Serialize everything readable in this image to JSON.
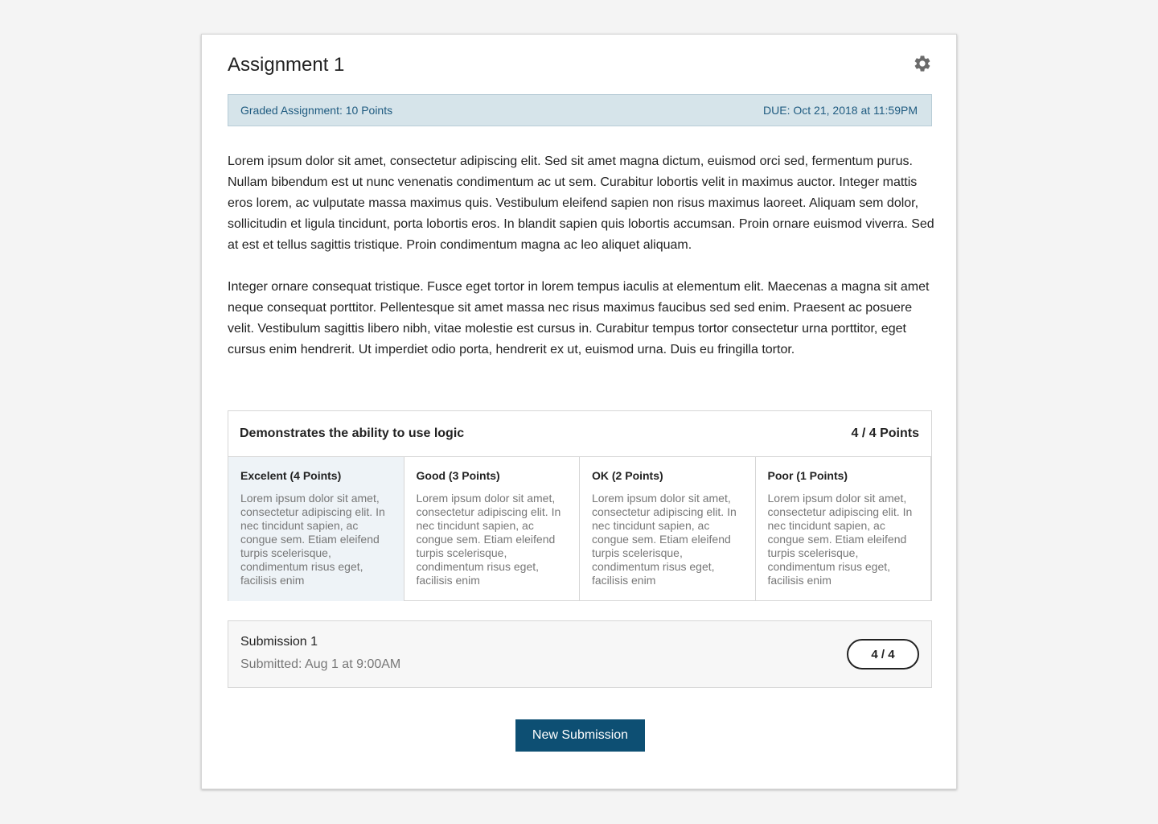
{
  "assignment": {
    "title": "Assignment 1",
    "settings_icon": "gear-icon",
    "graded_label": "Graded Assignment: 10 Points",
    "due_label": "DUE: Oct 21, 2018 at 11:59PM",
    "paragraphs": [
      "Lorem ipsum dolor sit amet, consectetur adipiscing elit. Sed sit amet magna dictum, euismod orci sed, fermentum purus. Nullam bibendum est ut nunc venenatis condimentum ac ut sem. Curabitur lobortis velit in maximus auctor. Integer mattis eros lorem, ac vulputate massa maximus quis. Vestibulum eleifend sapien non risus maximus laoreet. Aliquam sem dolor, sollicitudin et ligula tincidunt, porta lobortis eros. In blandit sapien quis lobortis accumsan. Proin ornare euismod viverra. Sed at est et tellus sagittis tristique. Proin condimentum magna ac leo aliquet aliquam.",
      "Integer ornare consequat tristique. Fusce eget tortor in lorem tempus iaculis at elementum elit. Maecenas a magna sit amet neque consequat porttitor. Pellentesque sit amet massa nec risus maximus faucibus sed sed enim. Praesent ac posuere velit. Vestibulum sagittis libero nibh, vitae molestie est cursus in. Curabitur tempus tortor consectetur urna porttitor, eget cursus enim hendrerit. Ut imperdiet odio porta, hendrerit ex ut, euismod urna. Duis eu fringilla tortor."
    ]
  },
  "rubric": {
    "title": "Demonstrates the ability to use logic",
    "score": "4 / 4 Points",
    "criteria": [
      {
        "label": "Excelent (4 Points)",
        "description": "Lorem ipsum dolor sit amet, consectetur adipiscing elit. In nec tincidunt sapien, ac congue sem. Etiam eleifend turpis scelerisque, condimentum risus eget, facilisis enim",
        "selected": true
      },
      {
        "label": "Good (3 Points)",
        "description": "Lorem ipsum dolor sit amet, consectetur adipiscing elit. In nec tincidunt sapien, ac congue sem. Etiam eleifend turpis scelerisque, condimentum risus eget, facilisis enim",
        "selected": false
      },
      {
        "label": "OK (2 Points)",
        "description": "Lorem ipsum dolor sit amet, consectetur adipiscing elit. In nec tincidunt sapien, ac congue sem. Etiam eleifend turpis scelerisque, condimentum risus eget, facilisis enim",
        "selected": false
      },
      {
        "label": "Poor (1 Points)",
        "description": "Lorem ipsum dolor sit amet, consectetur adipiscing elit. In nec tincidunt sapien, ac congue sem. Etiam eleifend turpis scelerisque, condimentum risus eget, facilisis enim",
        "selected": false
      }
    ]
  },
  "submission": {
    "title": "Submission 1",
    "submitted": "Submitted: Aug 1 at 9:00AM",
    "score": "4 / 4"
  },
  "actions": {
    "new_submission_label": "New Submission"
  },
  "colors": {
    "page_background": "#f4f4f4",
    "info_bar_background": "#d6e4ea",
    "info_bar_text": "#1f5b80",
    "selected_criterion_background": "#eef3f7",
    "primary_button": "#0d4f73"
  }
}
